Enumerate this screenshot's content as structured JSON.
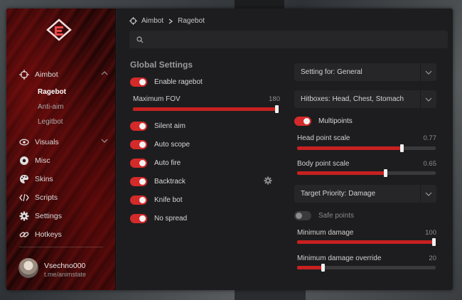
{
  "sidebar": {
    "nav": [
      {
        "key": "aimbot",
        "label": "Aimbot",
        "icon": "crosshair-icon"
      },
      {
        "key": "visuals",
        "label": "Visuals",
        "icon": "eye-icon"
      },
      {
        "key": "misc",
        "label": "Misc",
        "icon": "misc-icon"
      },
      {
        "key": "skins",
        "label": "Skins",
        "icon": "palette-icon"
      },
      {
        "key": "scripts",
        "label": "Scripts",
        "icon": "code-icon"
      },
      {
        "key": "settings",
        "label": "Settings",
        "icon": "gear-icon"
      },
      {
        "key": "hotkeys",
        "label": "Hotkeys",
        "icon": "link-icon"
      }
    ],
    "aimbot_sub": [
      {
        "label": "Ragebot",
        "active": true
      },
      {
        "label": "Anti-aim",
        "active": false
      },
      {
        "label": "Legitbot",
        "active": false
      }
    ],
    "user": {
      "name": "Vsechno000",
      "subtitle": "t.me/animstate"
    }
  },
  "breadcrumb": {
    "root": "Aimbot",
    "current": "Ragebot"
  },
  "search": {
    "placeholder": "",
    "value": ""
  },
  "left": {
    "title": "Global Settings",
    "enable": {
      "label": "Enable ragebot",
      "on": true
    },
    "fov": {
      "label": "Maximum FOV",
      "value": "180",
      "fraction": 1.0
    },
    "toggles": [
      {
        "label": "Silent aim",
        "on": true
      },
      {
        "label": "Auto scope",
        "on": true
      },
      {
        "label": "Auto fire",
        "on": true
      },
      {
        "label": "Backtrack",
        "on": true
      },
      {
        "label": "Knife bot",
        "on": true
      },
      {
        "label": "No spread",
        "on": true
      }
    ]
  },
  "right": {
    "setting_for": "Setting for: General",
    "hitboxes": "Hitboxes: Head, Chest, Stomach",
    "multipoints": {
      "label": "Multipoints",
      "on": true
    },
    "head_scale": {
      "label": "Head point scale",
      "value": "0.77",
      "fraction": 0.77
    },
    "body_scale": {
      "label": "Body point scale",
      "value": "0.65",
      "fraction": 0.65
    },
    "target_priority": "Target Priority: Damage",
    "safe_points": {
      "label": "Safe points",
      "on": false
    },
    "min_damage": {
      "label": "Minimum damage",
      "value": "100",
      "fraction": 1.0
    },
    "min_damage_override": {
      "label": "Minimum damage override",
      "value": "20",
      "fraction": 0.2
    }
  },
  "colors": {
    "accent": "#c72020",
    "toggle_on": "#d42a2a",
    "panel": "#1d1d1f"
  }
}
